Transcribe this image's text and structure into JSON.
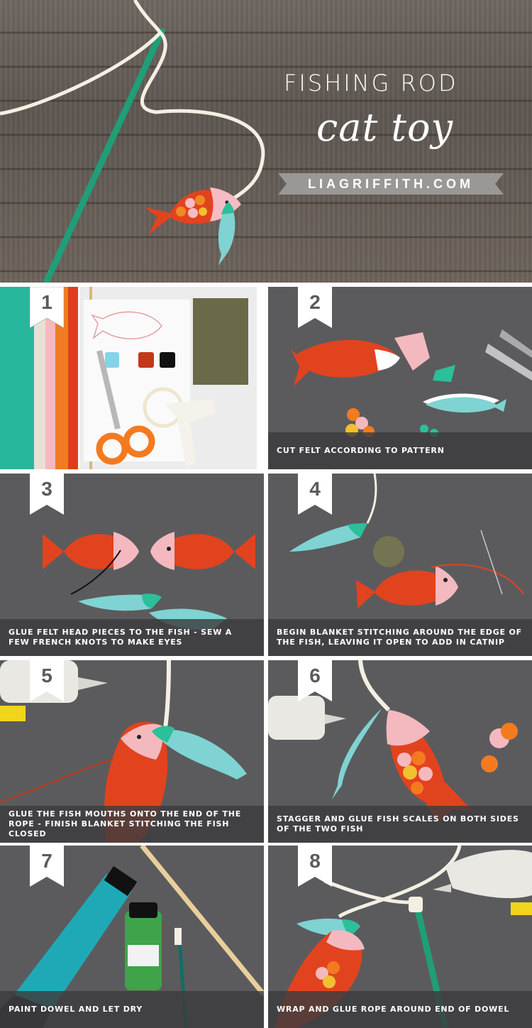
{
  "hero": {
    "title_line1": "FISHING ROD",
    "title_line2": "cat toy",
    "site": "LIAGRIFFITH.COM"
  },
  "steps": [
    {
      "number": "1",
      "caption": ""
    },
    {
      "number": "2",
      "caption": "CUT FELT ACCORDING TO PATTERN"
    },
    {
      "number": "3",
      "caption": "GLUE FELT HEAD PIECES TO THE FISH - SEW A FEW FRENCH KNOTS TO MAKE EYES"
    },
    {
      "number": "4",
      "caption": "BEGIN BLANKET STITCHING AROUND THE EDGE OF THE FISH, LEAVING IT OPEN TO ADD IN CATNIP"
    },
    {
      "number": "5",
      "caption": "GLUE THE FISH MOUTHS ONTO THE END OF THE ROPE - FINISH BLANKET STITCHING THE FISH CLOSED"
    },
    {
      "number": "6",
      "caption": "STAGGER AND GLUE FISH SCALES ON BOTH SIDES OF THE TWO FISH"
    },
    {
      "number": "7",
      "caption": "PAINT DOWEL AND LET DRY"
    },
    {
      "number": "8",
      "caption": "WRAP AND GLUE ROPE AROUND END OF DOWEL"
    }
  ],
  "colors": {
    "felt_red": "#e2431f",
    "felt_pink": "#f4b9bf",
    "felt_teal": "#7fd3d3",
    "felt_green": "#2bbf9a",
    "dowel_green": "#1a9e78",
    "scissors_orange": "#f47a20",
    "panel_gray": "#5b5b5d"
  }
}
